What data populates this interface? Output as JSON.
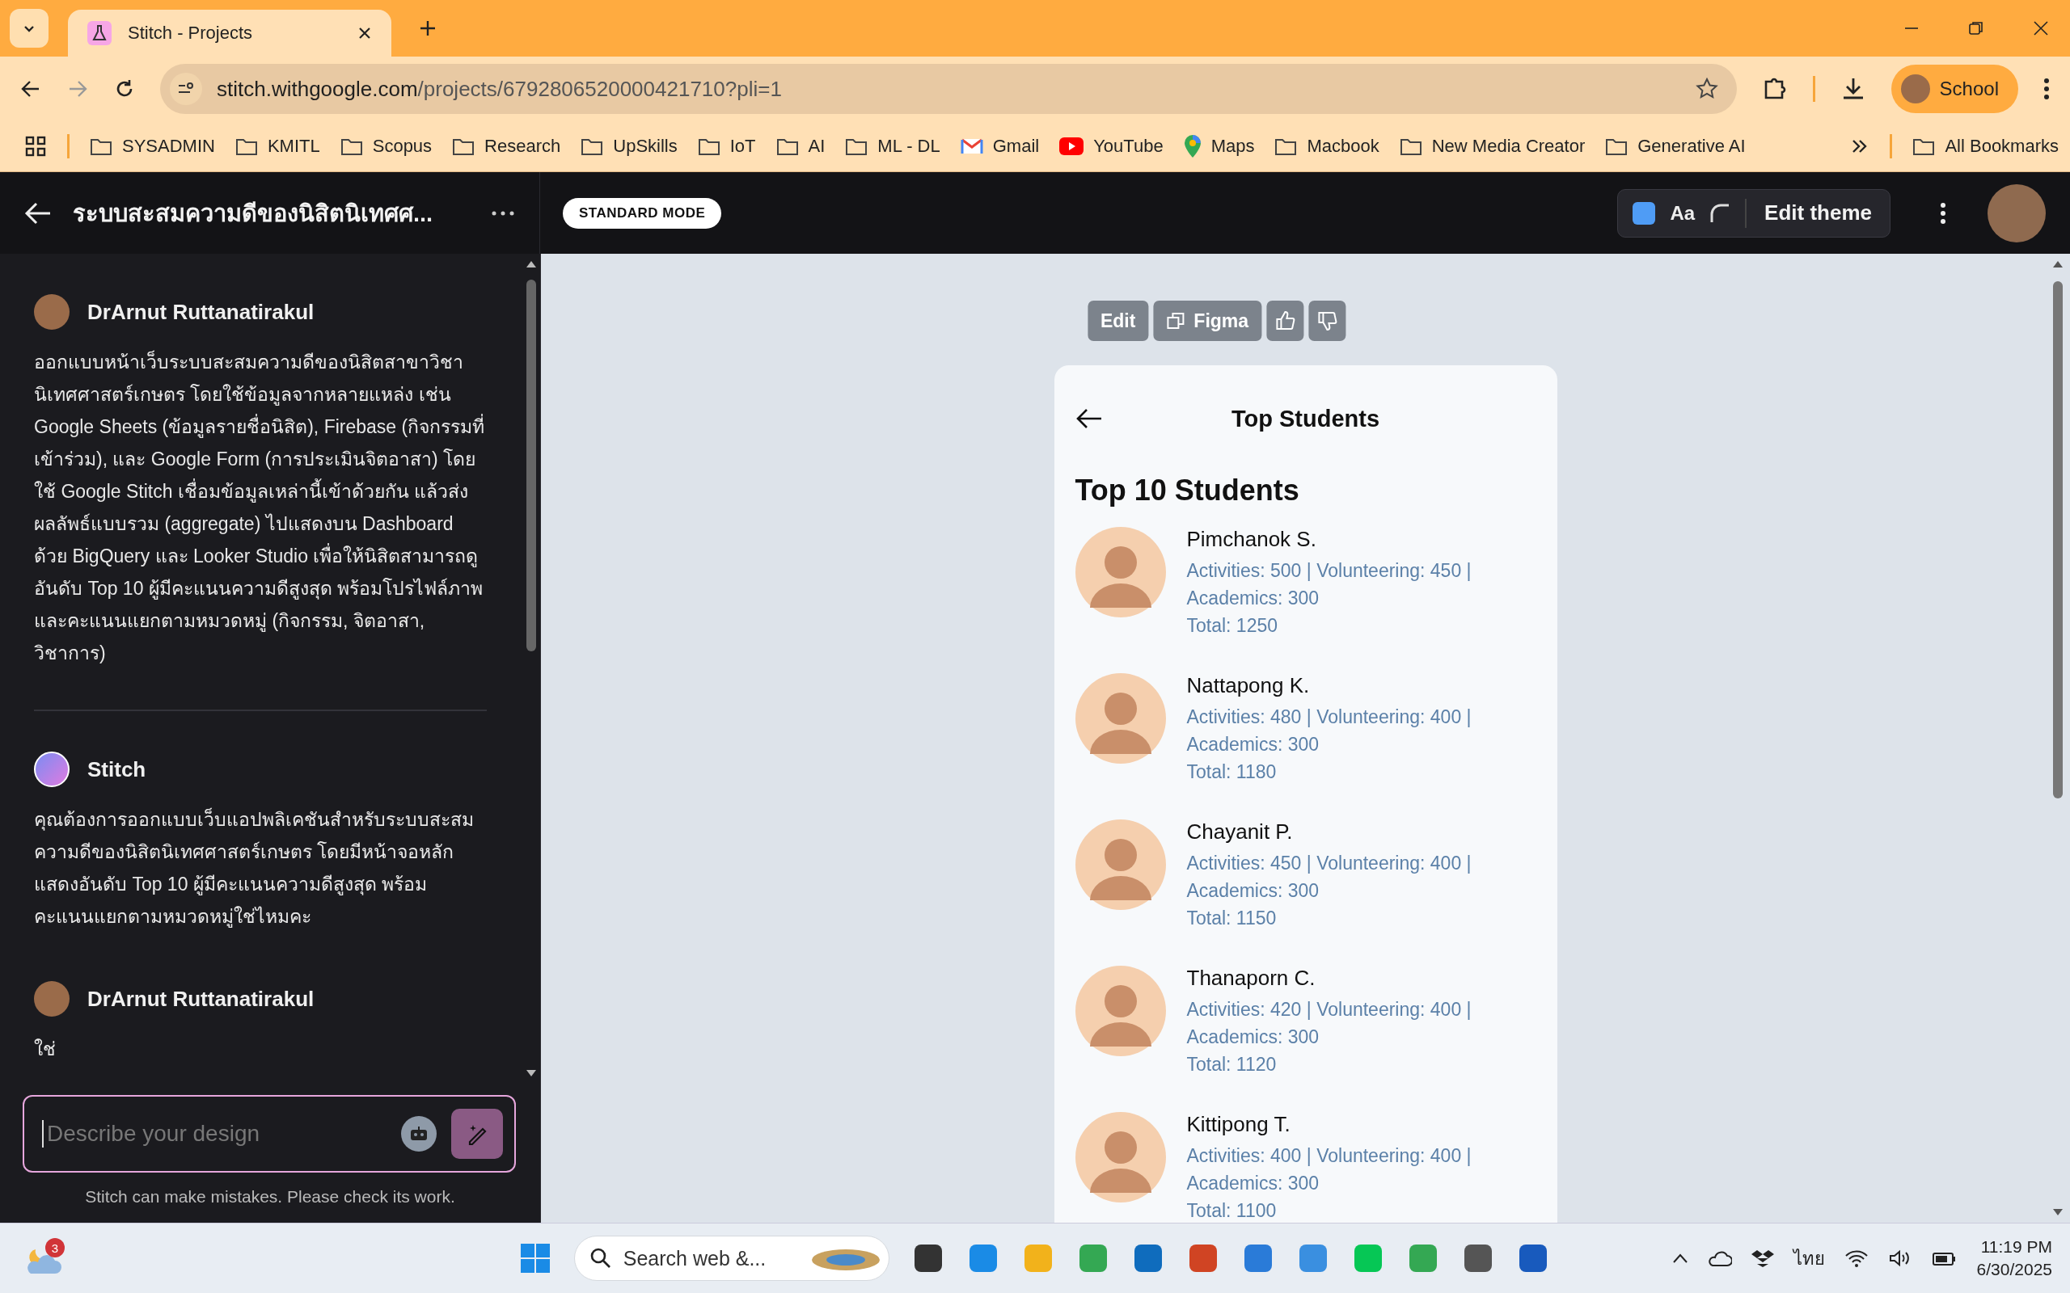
{
  "browser": {
    "tabs": [
      {
        "title": "Stitch - Projects",
        "selected": true
      }
    ],
    "url_host": "stitch.withgoogle.com",
    "url_path": "/projects/6792806520000421710?pli=1",
    "profile": "School",
    "bookmarks": [
      {
        "label": "SYSADMIN",
        "kind": "folder"
      },
      {
        "label": "KMITL",
        "kind": "folder"
      },
      {
        "label": "Scopus",
        "kind": "folder"
      },
      {
        "label": "Research",
        "kind": "folder"
      },
      {
        "label": "UpSkills",
        "kind": "folder"
      },
      {
        "label": "IoT",
        "kind": "folder"
      },
      {
        "label": "AI",
        "kind": "folder"
      },
      {
        "label": "ML - DL",
        "kind": "folder"
      },
      {
        "label": "Gmail",
        "kind": "gmail"
      },
      {
        "label": "YouTube",
        "kind": "youtube"
      },
      {
        "label": "Maps",
        "kind": "maps"
      },
      {
        "label": "Macbook",
        "kind": "folder"
      },
      {
        "label": "New Media Creator",
        "kind": "folder"
      },
      {
        "label": "Generative AI",
        "kind": "folder"
      }
    ],
    "all_bookmarks": "All Bookmarks"
  },
  "app_header": {
    "title": "ระบบสะสมความดีของนิสิตนิเทศศ...",
    "mode": "STANDARD MODE",
    "theme_font": "Aa",
    "edit_theme": "Edit theme"
  },
  "chat": {
    "messages": [
      {
        "author": "DrArnut Ruttanatirakul",
        "kind": "user",
        "text": "ออกแบบหน้าเว็บระบบสะสมความดีของนิสิตสาขาวิชานิเทศศาสตร์เกษตร โดยใช้ข้อมูลจากหลายแหล่ง เช่น Google Sheets (ข้อมูลรายชื่อนิสิต), Firebase (กิจกรรมที่เข้าร่วม), และ Google Form (การประเมินจิตอาสา) โดยใช้ Google Stitch เชื่อมข้อมูลเหล่านี้เข้าด้วยกัน แล้วส่งผลลัพธ์แบบรวม (aggregate) ไปแสดงบน Dashboard ด้วย BigQuery และ Looker Studio เพื่อให้นิสิตสามารถดูอันดับ Top 10 ผู้มีคะแนนความดีสูงสุด พร้อมโปรไฟล์ภาพและคะแนนแยกตามหมวดหมู่ (กิจกรรม, จิตอาสา, วิชาการ)"
      },
      {
        "author": "Stitch",
        "kind": "bot",
        "text": "คุณต้องการออกแบบเว็บแอปพลิเคชันสำหรับระบบสะสมความดีของนิสิตนิเทศศาสตร์เกษตร โดยมีหน้าจอหลักแสดงอันดับ Top 10 ผู้มีคะแนนความดีสูงสุด พร้อมคะแนนแยกตามหมวดหมู่ใช่ไหมคะ"
      },
      {
        "author": "DrArnut Ruttanatirakul",
        "kind": "user",
        "text": "ใช่"
      }
    ],
    "input": {
      "placeholder": "Describe your design"
    },
    "disclaimer": "Stitch can make mistakes. Please check its work."
  },
  "preview": {
    "toolbar": [
      "Edit",
      "Figma"
    ],
    "screen": {
      "title": "Top Students",
      "heading": "Top 10 Students",
      "students": [
        {
          "name": "Pimchanok S.",
          "scores": "Activities: 500 | Volunteering: 450 |",
          "academics": "Academics: 300",
          "total": "Total: 1250"
        },
        {
          "name": "Nattapong K.",
          "scores": "Activities: 480 | Volunteering: 400 |",
          "academics": "Academics: 300",
          "total": "Total: 1180"
        },
        {
          "name": "Chayanit P.",
          "scores": "Activities: 450 | Volunteering: 400 |",
          "academics": "Academics: 300",
          "total": "Total: 1150"
        },
        {
          "name": "Thanaporn C.",
          "scores": "Activities: 420 | Volunteering: 400 |",
          "academics": "Academics: 300",
          "total": "Total: 1120"
        },
        {
          "name": "Kittipong T.",
          "scores": "Activities: 400 | Volunteering: 400 |",
          "academics": "Academics: 300",
          "total": "Total: 1100"
        }
      ]
    }
  },
  "taskbar": {
    "weather_badge": "3",
    "search": "Search web &...",
    "language": "ไทย",
    "time": "11:19 PM",
    "date": "6/30/2025"
  }
}
